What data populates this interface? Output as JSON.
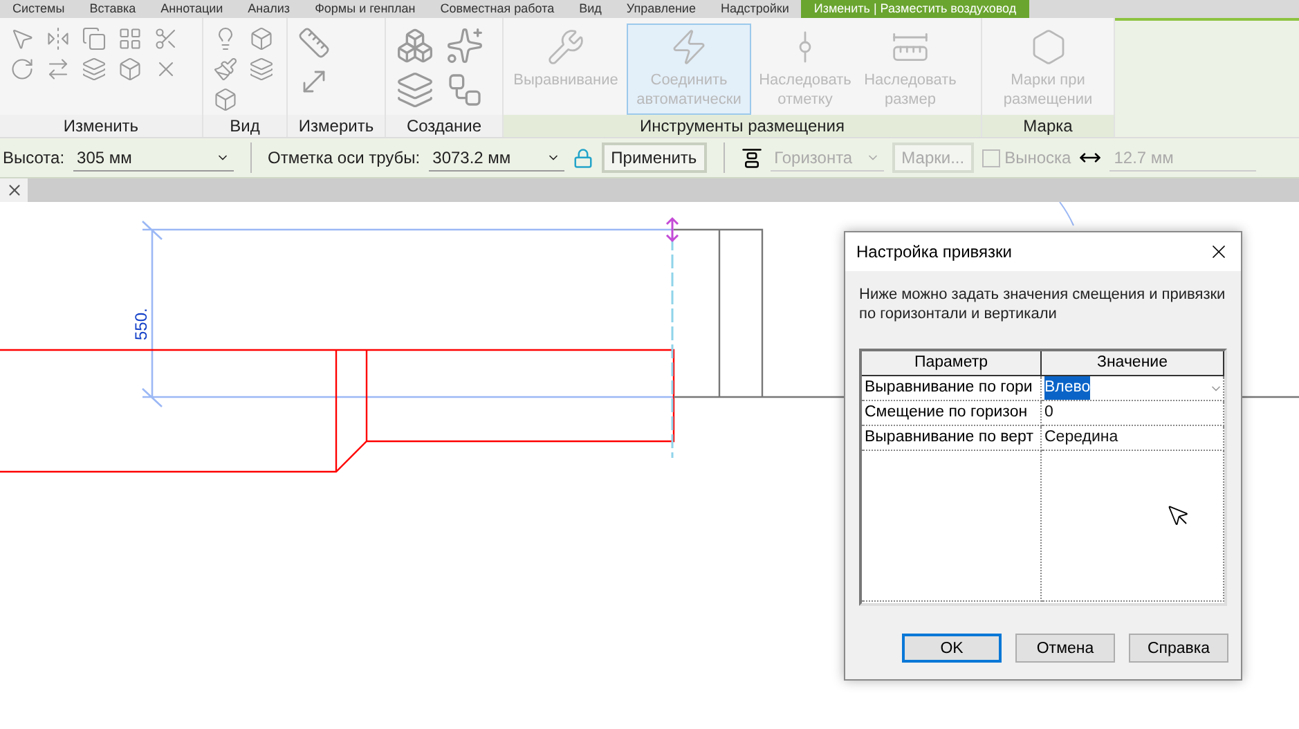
{
  "ribbon_tabs": [
    {
      "label": "Системы",
      "selected": false
    },
    {
      "label": "Вставка",
      "selected": false
    },
    {
      "label": "Аннотации",
      "selected": false
    },
    {
      "label": "Анализ",
      "selected": false
    },
    {
      "label": "Формы и генплан",
      "selected": false
    },
    {
      "label": "Совместная работа",
      "selected": false
    },
    {
      "label": "Вид",
      "selected": false
    },
    {
      "label": "Управление",
      "selected": false
    },
    {
      "label": "Надстройки",
      "selected": false
    },
    {
      "label": "Изменить | Разместить воздуховод",
      "selected": true
    }
  ],
  "ribbon_panels": [
    {
      "kind": "modify",
      "label": "Изменить"
    },
    {
      "kind": "view",
      "label": "Вид"
    },
    {
      "kind": "measure",
      "label": "Измерить"
    },
    {
      "kind": "create",
      "label": "Создание"
    },
    {
      "kind": "placement",
      "label": "Инструменты размещения",
      "buttons": [
        {
          "label": "Выравнивание",
          "disabled": true,
          "selected": false
        },
        {
          "label": "Соединить автоматически",
          "disabled": true,
          "selected": true
        },
        {
          "label": "Наследовать отметку",
          "disabled": true,
          "selected": false
        },
        {
          "label": "Наследовать размер",
          "disabled": true,
          "selected": false
        }
      ]
    },
    {
      "kind": "tag",
      "label": "Марка",
      "buttons": [
        {
          "label": "Марки при размещении",
          "disabled": true,
          "selected": false
        }
      ]
    }
  ],
  "options_bar": {
    "height_label": "Высота:",
    "height_value": "305 мм",
    "elevation_label": "Отметка оси трубы:",
    "elevation_value": "3073.2 мм",
    "apply_button": "Применить",
    "justify_value": "Горизонта",
    "tags_button": "Марки...",
    "leader": {
      "label": "Выноска",
      "checked": false,
      "disabled": true
    },
    "width_value": "12.7 мм"
  },
  "canvas": {
    "dimension_text": "550."
  },
  "dialog": {
    "title": "Настройка привязки",
    "description": "Ниже можно задать значения смещения и привязки по горизонтали и вертикали",
    "columns": [
      "Параметр",
      "Значение"
    ],
    "rows": [
      {
        "parameter": "Выравнивание по гори",
        "value": "Влево",
        "selected": true
      },
      {
        "parameter": "Смещение по горизон",
        "value": "0",
        "selected": false
      },
      {
        "parameter": "Выравнивание по верт",
        "value": "Середина",
        "selected": false
      }
    ],
    "buttons": [
      {
        "label": "OK",
        "default": true
      },
      {
        "label": "Отмена",
        "default": false
      },
      {
        "label": "Справка",
        "default": false
      }
    ]
  }
}
